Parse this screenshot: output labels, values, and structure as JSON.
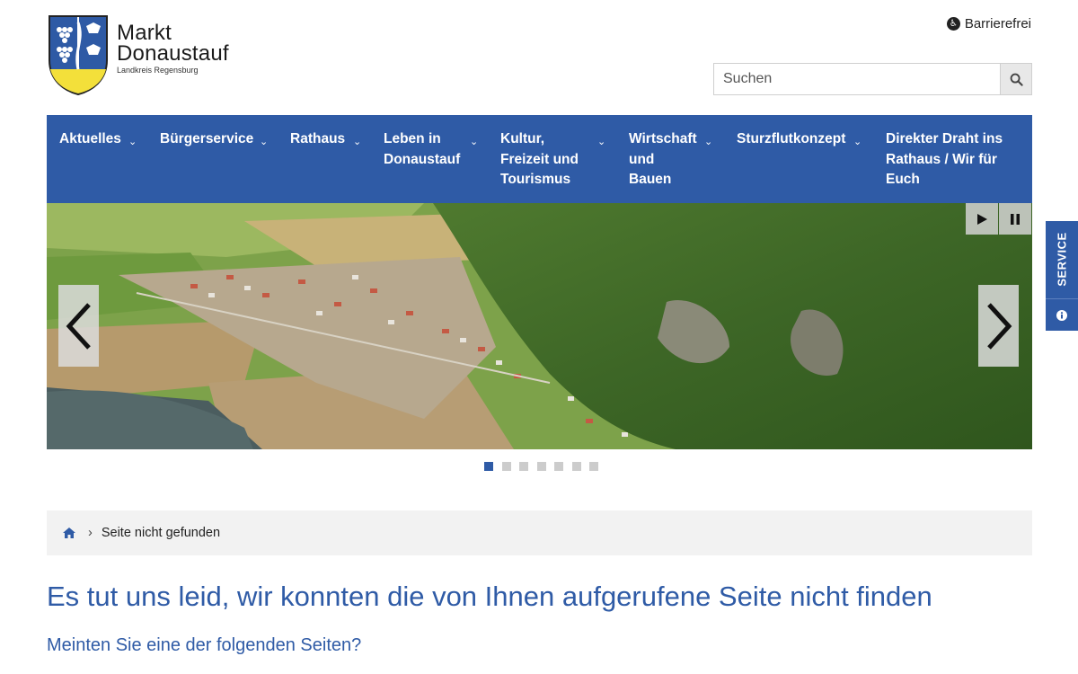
{
  "header": {
    "logo_title_line1": "Markt",
    "logo_title_line2": "Donaustauf",
    "logo_subtitle": "Landkreis Regensburg",
    "accessibility_label": "Barrierefrei",
    "search_placeholder": "Suchen"
  },
  "nav": {
    "items": [
      {
        "line1": "Aktuelles",
        "line2": "",
        "line3": ""
      },
      {
        "line1": "Bürgerservice",
        "line2": "",
        "line3": ""
      },
      {
        "line1": "Rathaus",
        "line2": "",
        "line3": ""
      },
      {
        "line1": "Leben in",
        "line2": "Donaustauf",
        "line3": ""
      },
      {
        "line1": "Kultur,",
        "line2": "Freizeit und",
        "line3": "Tourismus"
      },
      {
        "line1": "Wirtschaft",
        "line2": "und",
        "line3": "Bauen"
      },
      {
        "line1": "Sturzflutkonzept",
        "line2": "",
        "line3": ""
      },
      {
        "line1": "Direkter Draht ins",
        "line2": "Rathaus / Wir für",
        "line3": "Euch"
      }
    ]
  },
  "slider": {
    "slide_count": 7,
    "active_index": 0
  },
  "service": {
    "label": "SERVICE"
  },
  "breadcrumb": {
    "current": "Seite nicht gefunden"
  },
  "content": {
    "heading": "Es tut uns leid, wir konnten die von Ihnen aufgerufene Seite nicht finden",
    "subheading": "Meinten Sie eine der folgenden Seiten?"
  },
  "colors": {
    "brand_blue": "#2f5ba6",
    "breadcrumb_bg": "#f2f2f2",
    "dot_inactive": "#cccccc"
  }
}
